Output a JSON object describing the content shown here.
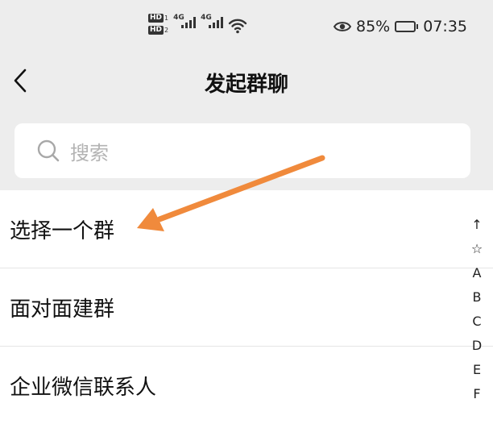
{
  "status_bar": {
    "sim1_badge": "HD",
    "sim2_badge": "HD",
    "sim1_tech": "4G",
    "sim2_tech": "4G",
    "battery_percent": "85%",
    "time": "07:35",
    "icons": [
      "eye-icon",
      "wifi-icon",
      "battery-icon",
      "signal-icon"
    ]
  },
  "header": {
    "title": "发起群聊",
    "back_icon": "chevron-left-icon"
  },
  "search": {
    "placeholder": "搜索",
    "icon": "search-icon"
  },
  "options": [
    {
      "label": "选择一个群"
    },
    {
      "label": "面对面建群"
    },
    {
      "label": "企业微信联系人"
    }
  ],
  "index_bar": [
    "↑",
    "☆",
    "A",
    "B",
    "C",
    "D",
    "E",
    "F"
  ],
  "annotation": {
    "arrow_color": "#f08a3c"
  }
}
